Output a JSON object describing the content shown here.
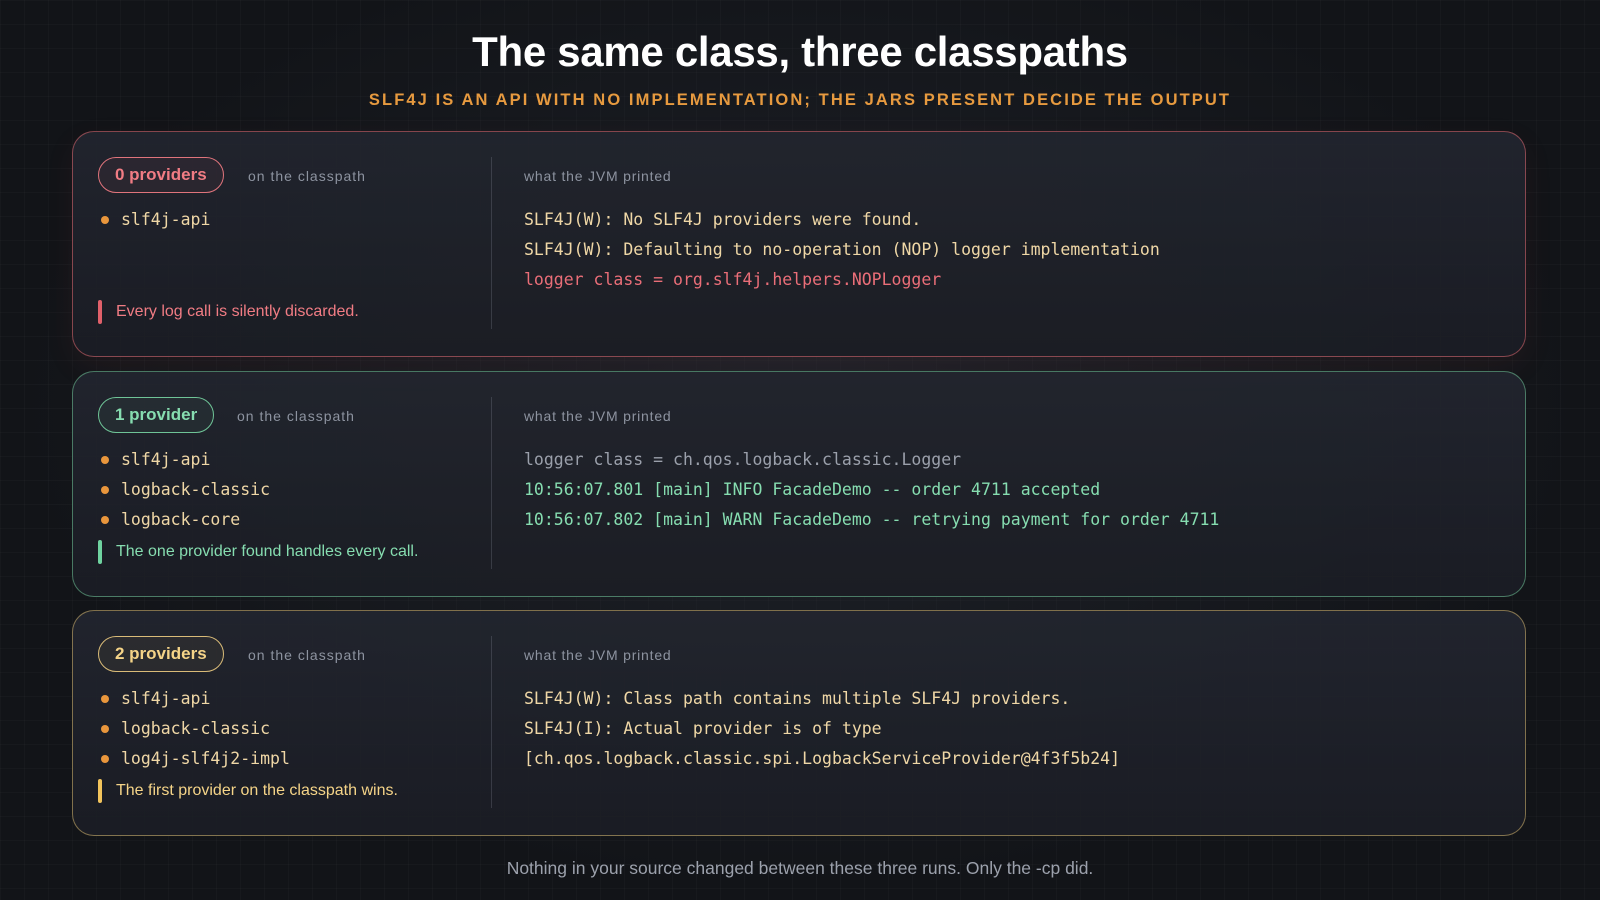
{
  "title": "The same class, three classpaths",
  "subtitle": "SLF4J IS AN API WITH NO IMPLEMENTATION; THE JARS PRESENT DECIDE THE OUTPUT",
  "panels": [
    {
      "badge": "0 providers",
      "classpath_label": "on the classpath",
      "jars": [
        "slf4j-api"
      ],
      "note": "Every log call is silently discarded.",
      "printed_label": "what the JVM printed",
      "output": [
        "SLF4J(W): No SLF4J providers were found.",
        "SLF4J(W): Defaulting to no-operation (NOP) logger implementation",
        "logger class = org.slf4j.helpers.NOPLogger"
      ],
      "accent_color": "#e0747c"
    },
    {
      "badge": "1 provider",
      "classpath_label": "on the classpath",
      "jars": [
        "slf4j-api",
        "logback-classic",
        "logback-core"
      ],
      "note": "The one provider found handles every call.",
      "printed_label": "what the JVM printed",
      "output": [
        "logger class = ch.qos.logback.classic.Logger",
        "10:56:07.801 [main] INFO FacadeDemo -- order 4711 accepted",
        "10:56:07.802 [main] WARN FacadeDemo -- retrying payment for order 4711"
      ],
      "accent_color": "#6fc497"
    },
    {
      "badge": "2 providers",
      "classpath_label": "on the classpath",
      "jars": [
        "slf4j-api",
        "logback-classic",
        "log4j-slf4j2-impl"
      ],
      "note": "The first provider on the classpath wins.",
      "printed_label": "what the JVM printed",
      "output": [
        "SLF4J(W): Class path contains multiple SLF4J providers.",
        "SLF4J(I): Actual provider is of type",
        "[ch.qos.logback.classic.spi.LogbackServiceProvider@4f3f5b24]"
      ],
      "accent_color": "#d9bb78"
    }
  ],
  "footer": "Nothing in your source changed between these three runs. Only the -cp did."
}
